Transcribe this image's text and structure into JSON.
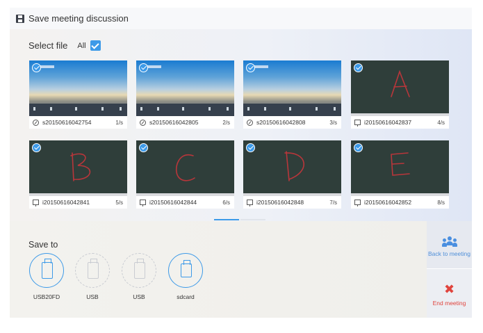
{
  "header": {
    "title": "Save meeting discussion",
    "icon": "floppy-disk-icon"
  },
  "select": {
    "label": "Select file",
    "all_label": "All",
    "all_checked": true
  },
  "files": [
    {
      "name": "s20150616042754",
      "count": "1/s",
      "type": "screenshot",
      "checked": true
    },
    {
      "name": "s20150616042805",
      "count": "2/s",
      "type": "screenshot",
      "checked": true
    },
    {
      "name": "s20150616042808",
      "count": "3/s",
      "type": "screenshot",
      "checked": true
    },
    {
      "name": "i20150616042837",
      "count": "4/s",
      "type": "whiteboard",
      "checked": true
    },
    {
      "name": "i20150616042841",
      "count": "5/s",
      "type": "whiteboard",
      "checked": true
    },
    {
      "name": "i20150616042844",
      "count": "6/s",
      "type": "whiteboard",
      "checked": true
    },
    {
      "name": "i20150616042848",
      "count": "7/s",
      "type": "whiteboard",
      "checked": true
    },
    {
      "name": "i20150616042852",
      "count": "8/s",
      "type": "whiteboard",
      "checked": true
    }
  ],
  "save_to": {
    "label": "Save to",
    "devices": [
      {
        "label": "USB20FD",
        "state": "selected"
      },
      {
        "label": "USB",
        "state": "unavailable"
      },
      {
        "label": "USB",
        "state": "unavailable"
      },
      {
        "label": "sdcard",
        "state": "available"
      }
    ]
  },
  "side": {
    "back_label": "Back to meeting",
    "end_label": "End meeting"
  },
  "colors": {
    "accent": "#3d9ae8",
    "danger": "#e0443d",
    "board": "#2f3e3a",
    "ink": "#b8363a"
  }
}
